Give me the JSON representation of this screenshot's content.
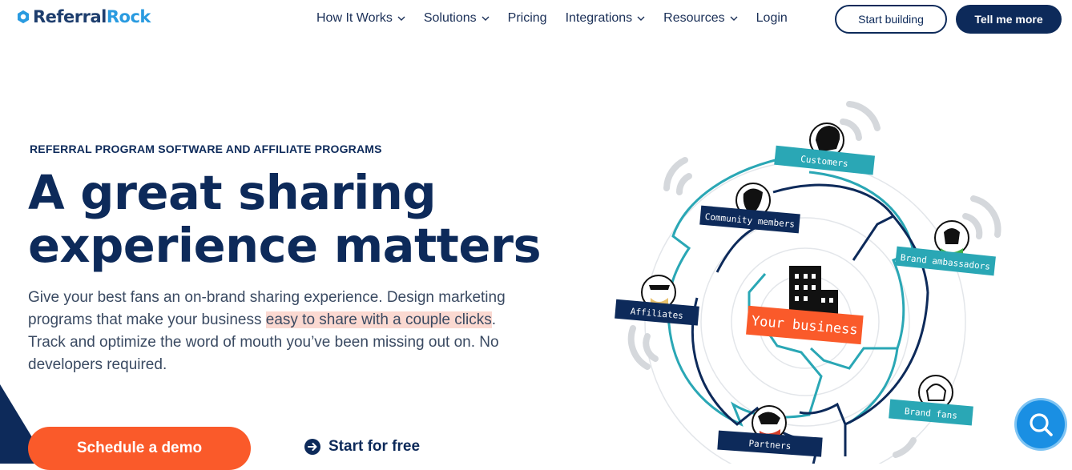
{
  "brand": {
    "name_part1": "Referral",
    "name_part2": "Rock"
  },
  "nav": {
    "items": [
      {
        "label": "How It Works",
        "dropdown": true
      },
      {
        "label": "Solutions",
        "dropdown": true
      },
      {
        "label": "Pricing",
        "dropdown": false
      },
      {
        "label": "Integrations",
        "dropdown": true
      },
      {
        "label": "Resources",
        "dropdown": true
      },
      {
        "label": "Login",
        "dropdown": false
      }
    ],
    "start_building": "Start building",
    "tell_me_more": "Tell me more"
  },
  "hero": {
    "eyebrow": "REFERRAL PROGRAM SOFTWARE AND AFFILIATE PROGRAMS",
    "headline_line1": "A great sharing",
    "headline_line2": "experience matters",
    "body_part1": "Give your best fans an on-brand sharing experience. Design marketing programs that make your business ",
    "body_highlight": "easy to share with a couple clicks",
    "body_part2": ". Track and optimize the word of mouth you’ve been missing out on. No developers required.",
    "cta_demo": "Schedule a demo",
    "cta_free": "Start for free"
  },
  "illustration": {
    "center_label": "Your business",
    "tags": {
      "customers": "Customers",
      "community": "Community members",
      "ambassadors": "Brand ambassadors",
      "affiliates": "Affiliates",
      "fans": "Brand fans",
      "partners": "Partners"
    }
  },
  "colors": {
    "navy": "#0d2a5a",
    "orange": "#fa5a2a",
    "teal": "#2aa7b5",
    "highlight": "#fbd9d1",
    "search_blue": "#1a8fe3"
  },
  "icons": [
    "logo-gear-icon",
    "chevron-down-icon",
    "arrow-right-circle-icon",
    "search-icon"
  ]
}
